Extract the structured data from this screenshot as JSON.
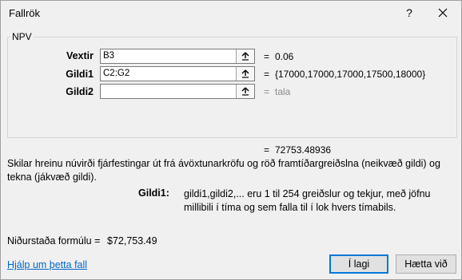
{
  "window": {
    "title": "Fallrök",
    "help_label": "?",
    "close_icon": "close-icon"
  },
  "group": {
    "label": "NPV"
  },
  "args": [
    {
      "label": "Vextir",
      "value": "B3",
      "result": "0.06",
      "placeholder": false
    },
    {
      "label": "Gildi1",
      "value": "C2:G2",
      "result": "{17000,17000,17000,17500,18000}",
      "placeholder": false
    },
    {
      "label": "Gildi2",
      "value": "",
      "result": "tala",
      "placeholder": true
    }
  ],
  "overall_result": {
    "eq": "=",
    "value": "72753.48936"
  },
  "description": "Skilar hreinu núvirði fjárfestingar út frá ávöxtunarkröfu og röð framtíðargreiðslna (neikvæð gildi) og tekna (jákvæð gildi).",
  "arg_help": {
    "label": "Gildi1:",
    "text": "gildi1,gildi2,... eru 1 til 254 greiðslur og tekjur, með jöfnu millibili í tíma og sem falla til í lok hvers tímabils."
  },
  "formula_result": {
    "label": "Niðurstaða formúlu =",
    "value": "$72,753.49"
  },
  "help_link": "Hjálp um þetta fall",
  "buttons": {
    "ok": "Í lagi",
    "cancel": "Hætta við"
  },
  "eq_sign": "="
}
